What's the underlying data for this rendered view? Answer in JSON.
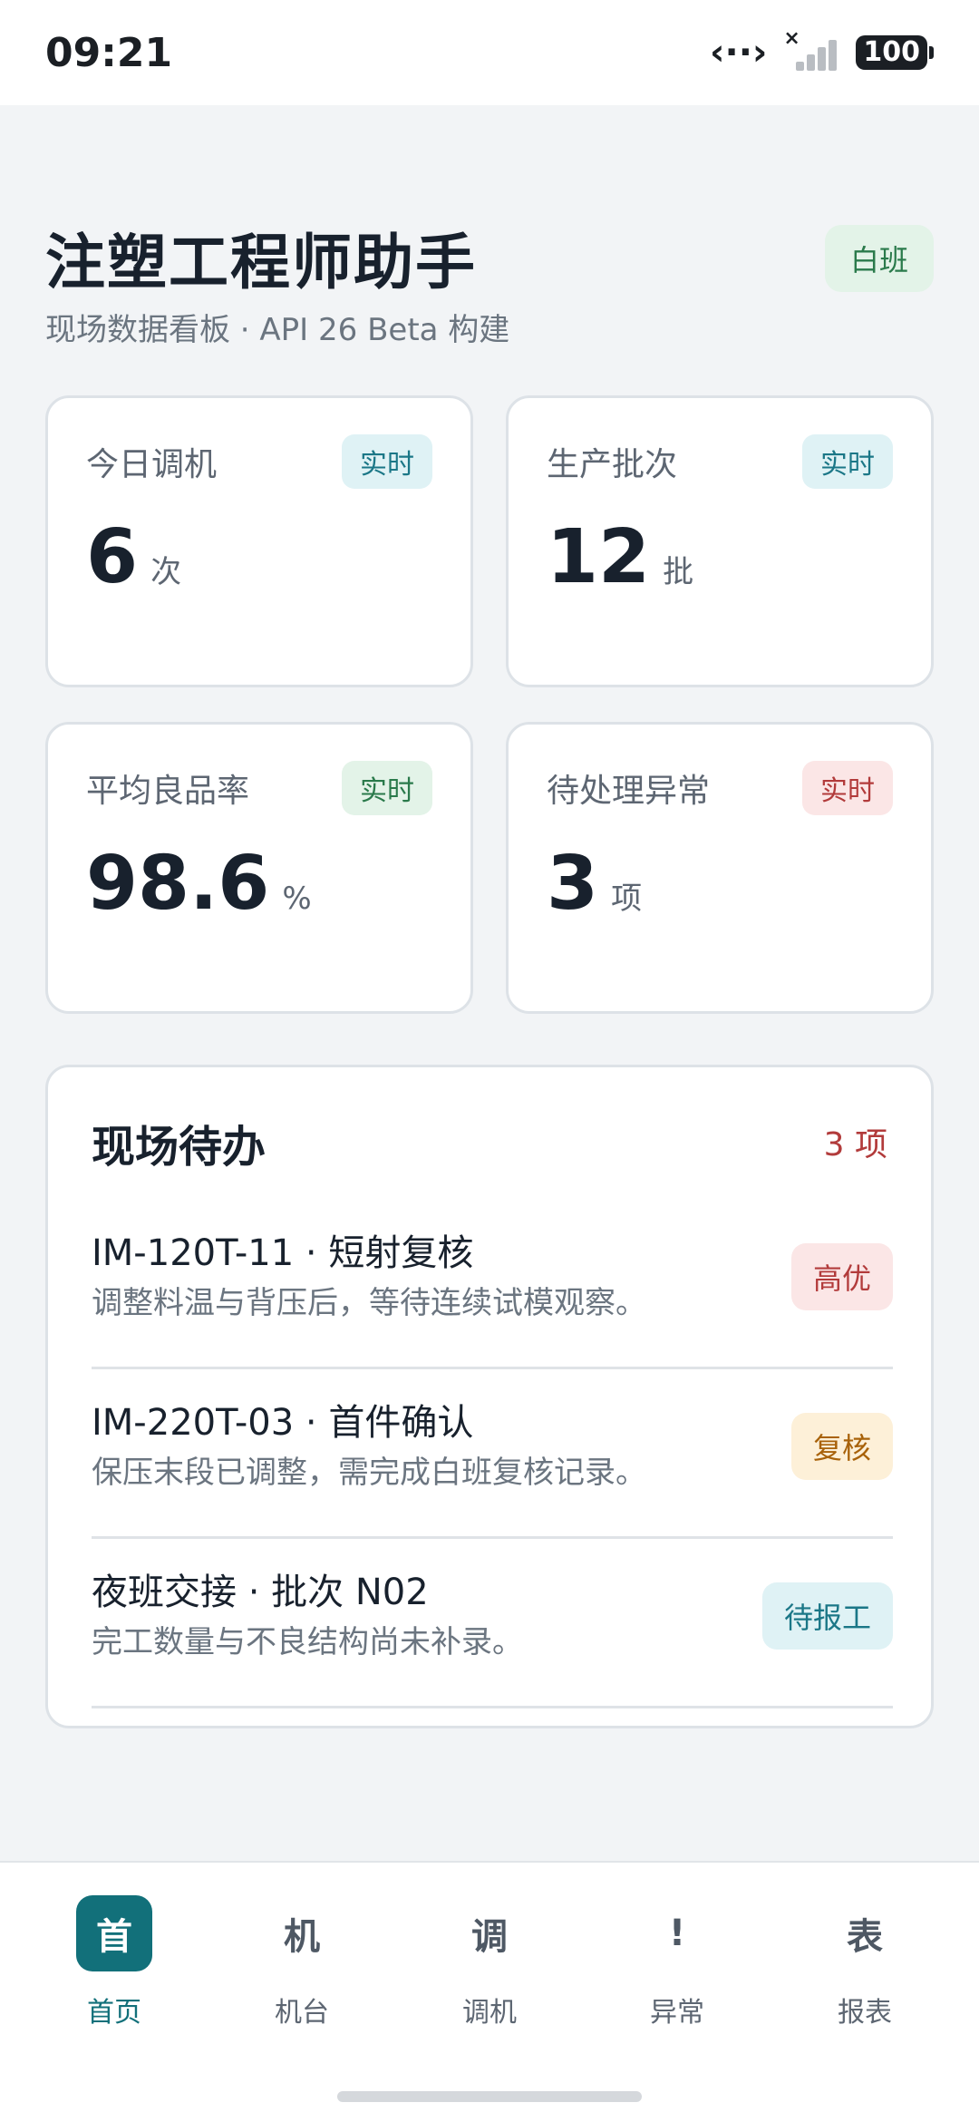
{
  "status_bar": {
    "time": "09:21",
    "battery": "100"
  },
  "header": {
    "title": "注塑工程师助手",
    "subtitle": "现场数据看板 · API 26 Beta 构建",
    "shift_badge": "白班"
  },
  "stats": [
    {
      "label": "今日调机",
      "tag": "实时",
      "value": "6",
      "unit": "次"
    },
    {
      "label": "生产批次",
      "tag": "实时",
      "value": "12",
      "unit": "批"
    },
    {
      "label": "平均良品率",
      "tag": "实时",
      "value": "98.6",
      "unit": "%"
    },
    {
      "label": "待处理异常",
      "tag": "实时",
      "value": "3",
      "unit": "项"
    }
  ],
  "todo": {
    "title": "现场待办",
    "count": "3 项",
    "items": [
      {
        "title": "IM-120T-11 · 短射复核",
        "desc": "调整料温与背压后，等待连续试模观察。",
        "tag": "高优"
      },
      {
        "title": "IM-220T-03 · 首件确认",
        "desc": "保压末段已调整，需完成白班复核记录。",
        "tag": "复核"
      },
      {
        "title": "夜班交接 · 批次 N02",
        "desc": "完工数量与不良结构尚未补录。",
        "tag": "待报工"
      }
    ]
  },
  "nav": [
    {
      "glyph": "首",
      "label": "首页"
    },
    {
      "glyph": "机",
      "label": "机台"
    },
    {
      "glyph": "调",
      "label": "调机"
    },
    {
      "glyph": "!",
      "label": "异常"
    },
    {
      "glyph": "表",
      "label": "报表"
    }
  ],
  "colors": {
    "accent": "#12707a",
    "background": "#f2f4f6",
    "danger": "#b23b3b"
  },
  "icons": [
    "data-transfer-icon",
    "signal-icon",
    "battery-icon"
  ]
}
